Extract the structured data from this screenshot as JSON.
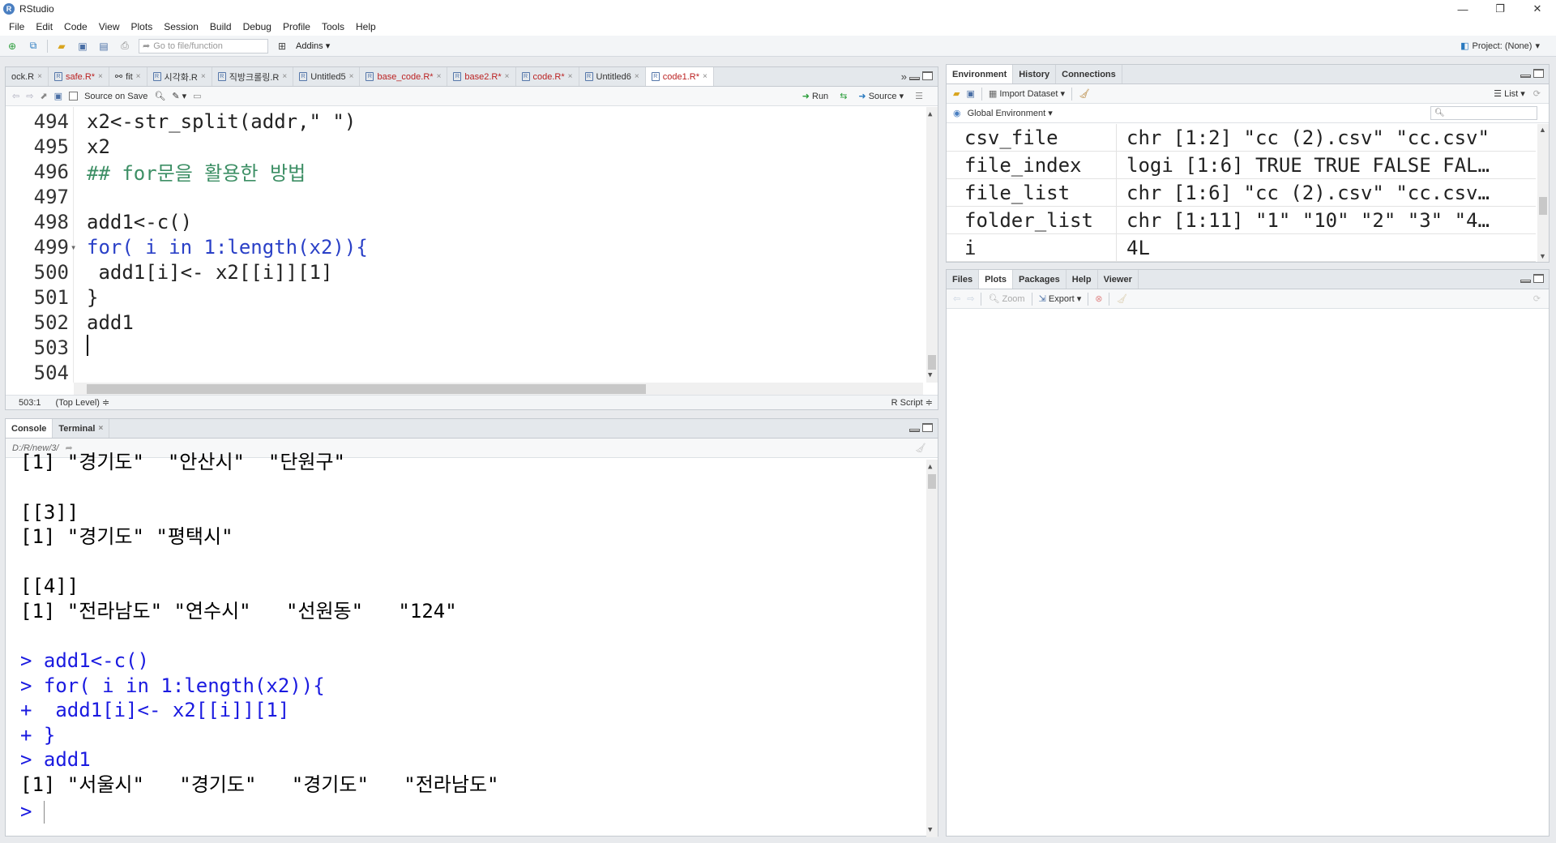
{
  "window": {
    "title": "RStudio",
    "controls": [
      "—",
      "❐",
      "✕"
    ]
  },
  "menu": [
    "File",
    "Edit",
    "Code",
    "View",
    "Plots",
    "Session",
    "Build",
    "Debug",
    "Profile",
    "Tools",
    "Help"
  ],
  "toolbar": {
    "goto_placeholder": "Go to file/function",
    "addins_label": "Addins",
    "project_label": "Project: (None)"
  },
  "editor": {
    "tabs": [
      {
        "label": "ock.R",
        "modified": false
      },
      {
        "label": "safe.R*",
        "modified": true
      },
      {
        "label": "fit",
        "modified": false
      },
      {
        "label": "시각화.R",
        "modified": false
      },
      {
        "label": "직방크롤링.R",
        "modified": false
      },
      {
        "label": "Untitled5",
        "modified": false
      },
      {
        "label": "base_code.R*",
        "modified": true
      },
      {
        "label": "base2.R*",
        "modified": true
      },
      {
        "label": "code.R*",
        "modified": true
      },
      {
        "label": "Untitled6",
        "modified": false
      },
      {
        "label": "code1.R*",
        "modified": true
      }
    ],
    "source_on_save_label": "Source on Save",
    "run_label": "Run",
    "source_label": "Source",
    "lines": [
      {
        "num": "494",
        "text": "x2<-str_split(addr,\" \")"
      },
      {
        "num": "495",
        "text": "x2"
      },
      {
        "num": "496",
        "text": "## for문을 활용한 방법"
      },
      {
        "num": "497",
        "text": ""
      },
      {
        "num": "498",
        "text": "add1<-c()"
      },
      {
        "num": "499",
        "text": "for( i in 1:length(x2)){"
      },
      {
        "num": "500",
        "text": " add1[i]<- x2[[i]][1]"
      },
      {
        "num": "501",
        "text": "}"
      },
      {
        "num": "502",
        "text": "add1"
      },
      {
        "num": "503",
        "text": ""
      },
      {
        "num": "504",
        "text": ""
      }
    ],
    "status": {
      "position": "503:1",
      "scope": "(Top Level) ≑",
      "filetype": "R Script ≑"
    }
  },
  "console": {
    "tabs": [
      "Console",
      "Terminal"
    ],
    "path": "D:/R/new/3/",
    "lines": [
      {
        "text": "[1] \"경기도\"  \"안산시\"  \"단원구\"",
        "input": false
      },
      {
        "text": "",
        "input": false
      },
      {
        "text": "[[3]]",
        "input": false
      },
      {
        "text": "[1] \"경기도\" \"평택시\"",
        "input": false
      },
      {
        "text": "",
        "input": false
      },
      {
        "text": "[[4]]",
        "input": false
      },
      {
        "text": "[1] \"전라남도\" \"연수시\"   \"선원동\"   \"124\"",
        "input": false
      },
      {
        "text": "",
        "input": false
      },
      {
        "text": "> add1<-c()",
        "input": true
      },
      {
        "text": "> for( i in 1:length(x2)){",
        "input": true
      },
      {
        "text": "+  add1[i]<- x2[[i]][1]",
        "input": true
      },
      {
        "text": "+ }",
        "input": true
      },
      {
        "text": "> add1",
        "input": true
      },
      {
        "text": "[1] \"서울시\"   \"경기도\"   \"경기도\"   \"전라남도\"",
        "input": false
      },
      {
        "text": "> ",
        "input": true
      }
    ]
  },
  "environment": {
    "tabs": [
      "Environment",
      "History",
      "Connections"
    ],
    "import_label": "Import Dataset",
    "list_label": "List",
    "scope_label": "Global Environment",
    "rows": [
      {
        "name": "csv_file",
        "value": "chr [1:2] \"cc (2).csv\" \"cc.csv\""
      },
      {
        "name": "file_index",
        "value": "logi [1:6] TRUE TRUE FALSE FAL…"
      },
      {
        "name": "file_list",
        "value": "chr [1:6] \"cc (2).csv\" \"cc.csv…"
      },
      {
        "name": "folder_list",
        "value": "chr [1:11] \"1\" \"10\" \"2\" \"3\" \"4…"
      },
      {
        "name": "i",
        "value": "4L"
      }
    ]
  },
  "files": {
    "tabs": [
      "Files",
      "Plots",
      "Packages",
      "Help",
      "Viewer"
    ],
    "zoom_label": "Zoom",
    "export_label": "Export"
  }
}
